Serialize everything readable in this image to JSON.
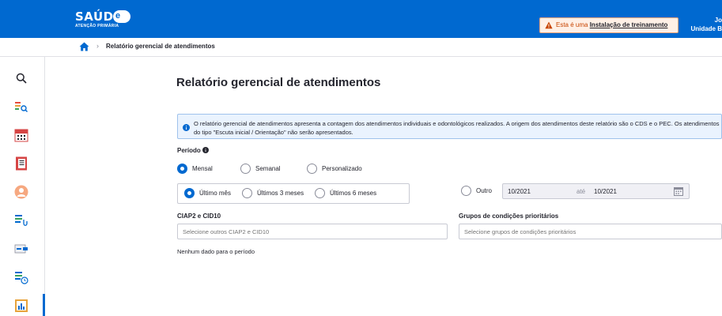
{
  "header": {
    "logo_text": "SAÚDE",
    "logo_sub": "ATENÇÃO PRIMÁRIA",
    "logo_badge": "e",
    "banner_prefix": "Esta é uma",
    "banner_link": "Instalação de treinamento",
    "user_line1": "Jo",
    "user_line2": "Unidade B"
  },
  "breadcrumb": {
    "current": "Relatório gerencial de atendimentos"
  },
  "sidebar": {
    "items": [
      "search-icon",
      "search-list-icon",
      "calendar-icon",
      "document-icon",
      "person-icon",
      "list-stethoscope-icon",
      "list-transfer-icon",
      "list-clock-icon",
      "report-chart-icon"
    ]
  },
  "main": {
    "title": "Relatório gerencial de atendimentos",
    "alert_text": "O relatório gerencial de atendimentos apresenta a contagem dos atendimentos individuais e odontológicos realizados. A origem dos atendimentos deste relatório são o CDS e o PEC. Os atendimentos do tipo \"Escuta inicial / Orientação\" não serão apresentados.",
    "period_label": "Período",
    "period_types": [
      "Mensal",
      "Semanal",
      "Personalizado"
    ],
    "period_selected": "Mensal",
    "ranges": [
      "Último mês",
      "Últimos 3 meses",
      "Últimos 6 meses"
    ],
    "range_selected": "Último mês",
    "other_label": "Outro",
    "date_from": "10/2021",
    "date_sep": "até",
    "date_to": "10/2021",
    "ciap_label": "CIAP2 e CID10",
    "ciap_placeholder": "Selecione outros CIAP2 e CID10",
    "groups_label": "Grupos de condições prioritários",
    "groups_placeholder": "Selecione grupos de condições prioritários",
    "empty_message": "Nenhum dado para o período"
  },
  "colors": {
    "brand_blue": "#0069d0",
    "warning_orange": "#c74400",
    "alert_bg": "#eaf3fe"
  }
}
